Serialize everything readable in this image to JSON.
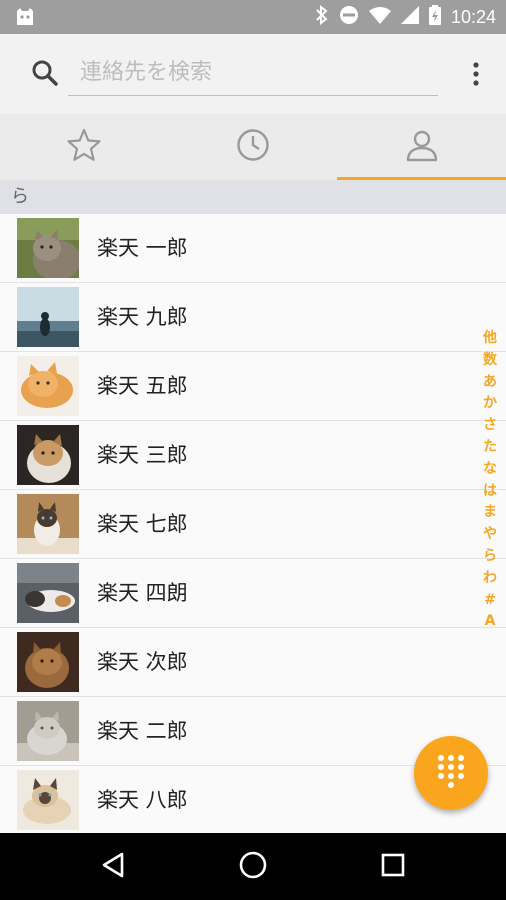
{
  "status_bar": {
    "time": "10:24",
    "icons": [
      "app-notification-icon",
      "bluetooth-icon",
      "do-not-disturb-icon",
      "wifi-icon",
      "cell-signal-icon",
      "battery-icon"
    ]
  },
  "search": {
    "placeholder": "連絡先を検索",
    "value": ""
  },
  "tabs": [
    {
      "name": "favorites",
      "icon": "star-icon",
      "active": false
    },
    {
      "name": "recent",
      "icon": "clock-icon",
      "active": false
    },
    {
      "name": "contacts",
      "icon": "person-icon",
      "active": true
    }
  ],
  "section_header": "ら",
  "contacts": [
    {
      "name": "楽天 一郎",
      "avatar": "cat-photo-1"
    },
    {
      "name": "楽天 九郎",
      "avatar": "cat-photo-2"
    },
    {
      "name": "楽天 五郎",
      "avatar": "cat-photo-3"
    },
    {
      "name": "楽天 三郎",
      "avatar": "cat-photo-4"
    },
    {
      "name": "楽天 七郎",
      "avatar": "cat-photo-5"
    },
    {
      "name": "楽天 四朗",
      "avatar": "cat-photo-6"
    },
    {
      "name": "楽天 次郎",
      "avatar": "cat-photo-7"
    },
    {
      "name": "楽天 二郎",
      "avatar": "cat-photo-8"
    },
    {
      "name": "楽天 八郎",
      "avatar": "cat-photo-9"
    }
  ],
  "alpha_index": [
    "他",
    "数",
    "あ",
    "か",
    "さ",
    "た",
    "な",
    "は",
    "ま",
    "や",
    "ら",
    "わ",
    "#",
    "A"
  ],
  "fab": {
    "icon": "dialpad-icon"
  },
  "nav_bar": {
    "icons": [
      "back-icon",
      "home-icon",
      "recents-icon"
    ]
  },
  "colors": {
    "accent": "#f5a623",
    "fab": "#f9a51e",
    "status_bar": "#9e9e9e"
  }
}
